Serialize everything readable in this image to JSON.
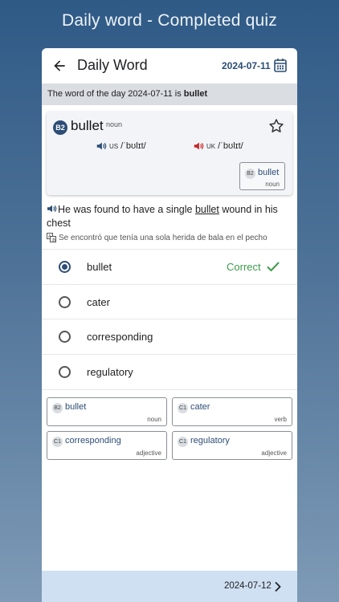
{
  "promo": {
    "title": "Daily word - Completed quiz"
  },
  "appbar": {
    "title": "Daily Word",
    "date": "2024-07-11"
  },
  "banner": {
    "prefix": "The word of the day 2024-07-11 is ",
    "word": "bullet"
  },
  "word_card": {
    "level": "B2",
    "word": "bullet",
    "pos": "noun",
    "pron_us": {
      "label": "US",
      "ipa": "/ˈbʊlɪt/",
      "color": "#2c4d75"
    },
    "pron_uk": {
      "label": "UK",
      "ipa": "/ˈbʊlɪt/",
      "color": "#c62828"
    },
    "mini": {
      "level": "B2",
      "word": "bullet",
      "pos": "noun"
    }
  },
  "example": {
    "before": "He was found to have a single ",
    "highlight": "bullet",
    "after": " wound in his chest",
    "translation": "Se encontró que tenía una sola herida de bala en el pecho"
  },
  "options": [
    {
      "label": "bullet",
      "selected": true,
      "status": "Correct"
    },
    {
      "label": "cater",
      "selected": false
    },
    {
      "label": "corresponding",
      "selected": false
    },
    {
      "label": "regulatory",
      "selected": false
    }
  ],
  "chips": [
    {
      "level": "B2",
      "word": "bullet",
      "pos": "noun"
    },
    {
      "level": "C1",
      "word": "cater",
      "pos": "verb"
    },
    {
      "level": "C1",
      "word": "corresponding",
      "pos": "adjective"
    },
    {
      "level": "C1",
      "word": "regulatory",
      "pos": "adjective"
    }
  ],
  "bottom": {
    "next_date": "2024-07-12"
  },
  "colors": {
    "accent": "#2c4d75",
    "correct": "#3d9a4b",
    "bottom_bar": "#cfe0f3"
  }
}
